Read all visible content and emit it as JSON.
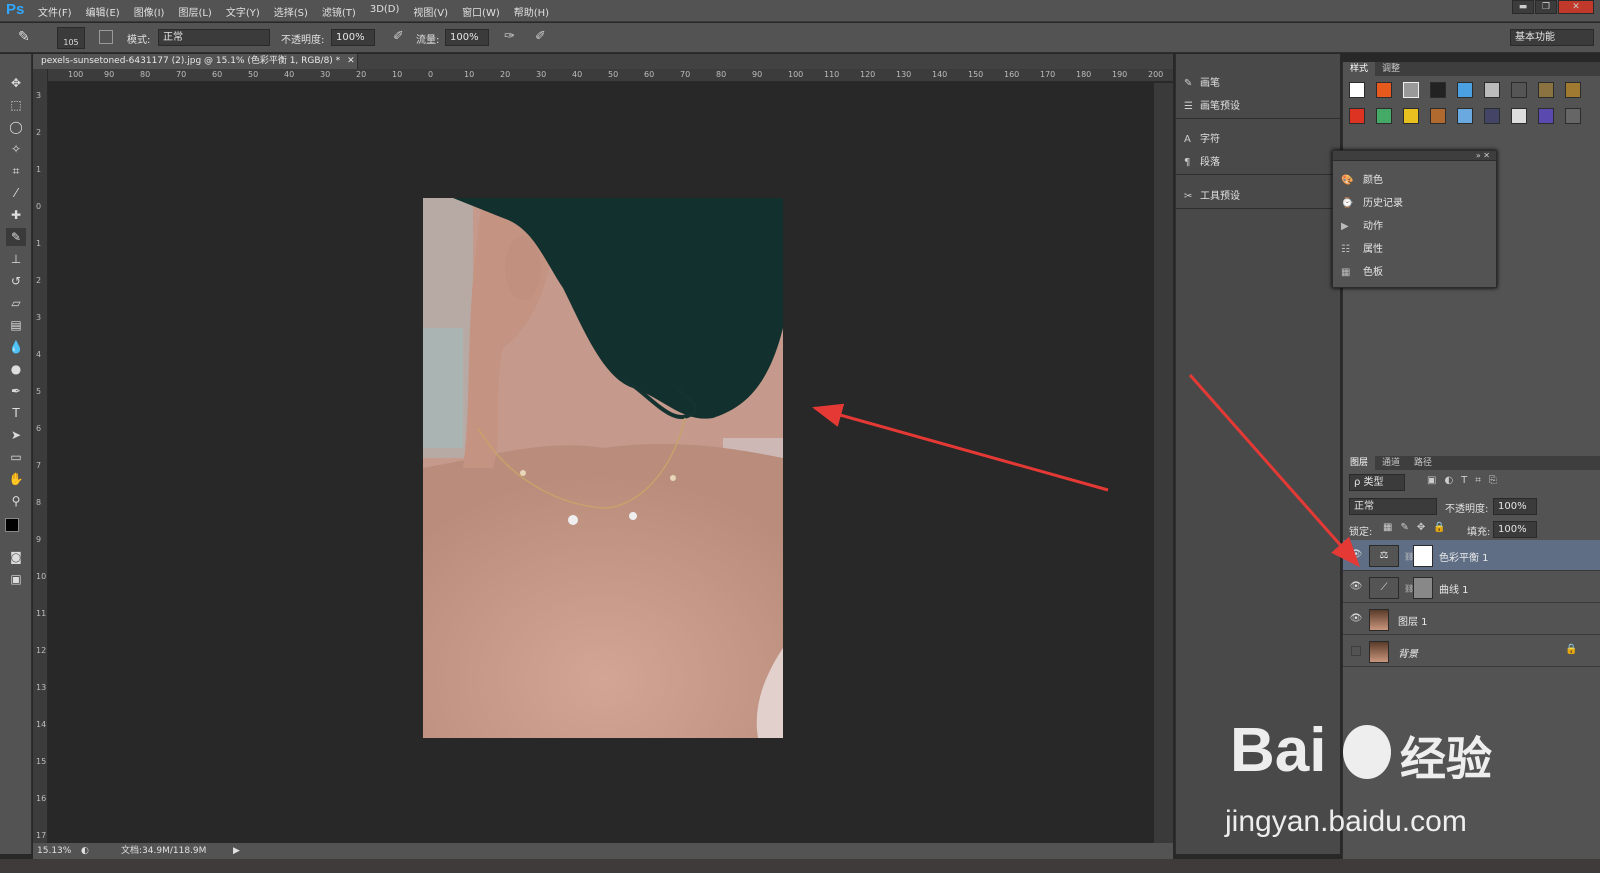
{
  "app": {
    "logo": "Ps"
  },
  "menu": [
    "文件(F)",
    "编辑(E)",
    "图像(I)",
    "图层(L)",
    "文字(Y)",
    "选择(S)",
    "滤镜(T)",
    "3D(D)",
    "视图(V)",
    "窗口(W)",
    "帮助(H)"
  ],
  "options": {
    "brush_size": "105",
    "mode_label": "模式:",
    "mode_value": "正常",
    "opacity_label": "不透明度:",
    "opacity_value": "100%",
    "flow_label": "流量:",
    "flow_value": "100%",
    "workspace": "基本功能"
  },
  "document": {
    "tab_title": "pexels-sunsetoned-6431177 (2).jpg @ 15.1% (色彩平衡 1, RGB/8) *",
    "zoom": "15.13%",
    "doc_info": "文档:34.9M/118.9M"
  },
  "ruler": {
    "h": [
      "100",
      "90",
      "80",
      "70",
      "60",
      "50",
      "40",
      "30",
      "20",
      "10",
      "0",
      "10",
      "20",
      "30",
      "40",
      "50",
      "60",
      "70",
      "80",
      "90",
      "100",
      "110",
      "120",
      "130",
      "140",
      "150",
      "160",
      "170",
      "180",
      "190",
      "200"
    ],
    "v": [
      "3",
      "2",
      "1",
      "0",
      "1",
      "2",
      "3",
      "4",
      "5",
      "6",
      "7",
      "8",
      "9",
      "10",
      "11",
      "12",
      "13",
      "14",
      "15",
      "16",
      "17"
    ]
  },
  "mid_panel": {
    "items": [
      "画笔",
      "画笔预设",
      "字符",
      "段落",
      "工具预设"
    ]
  },
  "styles_panel": {
    "tabs": [
      "样式",
      "调整"
    ]
  },
  "float_panel": {
    "items": [
      "颜色",
      "历史记录",
      "动作",
      "属性",
      "色板"
    ]
  },
  "layers_panel": {
    "tabs": [
      "图层",
      "通道",
      "路径"
    ],
    "filter_label": "ρ 类型",
    "blend_mode": "正常",
    "opacity_label": "不透明度:",
    "opacity_value": "100%",
    "lock_label": "锁定:",
    "fill_label": "填充:",
    "fill_value": "100%",
    "layers": [
      {
        "name": "色彩平衡 1",
        "visible": true,
        "selected": true
      },
      {
        "name": "曲线 1",
        "visible": true,
        "selected": false
      },
      {
        "name": "图层 1",
        "visible": true,
        "selected": false
      },
      {
        "name": "背景",
        "visible": false,
        "selected": false
      }
    ]
  },
  "watermark": {
    "brand": "Bai",
    "cn": "经验",
    "url": "jingyan.baidu.com"
  },
  "colors": {
    "annotation_arrow": "#e53935",
    "selected_layer": "#5f6e84",
    "ps_blue": "#31a8ff"
  }
}
